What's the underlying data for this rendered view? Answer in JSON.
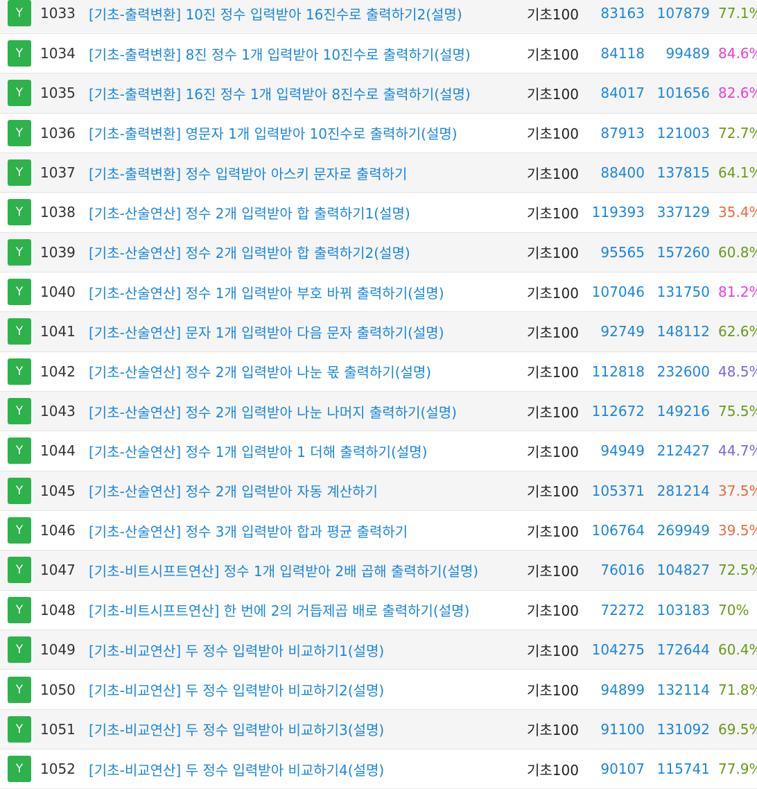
{
  "problems": [
    {
      "status": "Y",
      "id": "1033",
      "title": "[기초-출력변환] 10진 정수 입력받아 16진수로 출력하기2(설명)",
      "source": "기초100",
      "solved": "83163",
      "submitted": "107879",
      "rate": "77.1%",
      "rate_color": "#6a9a16"
    },
    {
      "status": "Y",
      "id": "1034",
      "title": "[기초-출력변환] 8진 정수 1개 입력받아 10진수로 출력하기(설명)",
      "source": "기초100",
      "solved": "84118",
      "submitted": "99489",
      "rate": "84.6%",
      "rate_color": "#e93ed8"
    },
    {
      "status": "Y",
      "id": "1035",
      "title": "[기초-출력변환] 16진 정수 1개 입력받아 8진수로 출력하기(설명)",
      "source": "기초100",
      "solved": "84017",
      "submitted": "101656",
      "rate": "82.6%",
      "rate_color": "#e93ed8"
    },
    {
      "status": "Y",
      "id": "1036",
      "title": "[기초-출력변환] 영문자 1개 입력받아 10진수로 출력하기(설명)",
      "source": "기초100",
      "solved": "87913",
      "submitted": "121003",
      "rate": "72.7%",
      "rate_color": "#6a9a16"
    },
    {
      "status": "Y",
      "id": "1037",
      "title": "[기초-출력변환] 정수 입력받아 아스키 문자로 출력하기",
      "source": "기초100",
      "solved": "88400",
      "submitted": "137815",
      "rate": "64.1%",
      "rate_color": "#6a9a16"
    },
    {
      "status": "Y",
      "id": "1038",
      "title": "[기초-산술연산] 정수 2개 입력받아 합 출력하기1(설명)",
      "source": "기초100",
      "solved": "119393",
      "submitted": "337129",
      "rate": "35.4%",
      "rate_color": "#ee6a3a"
    },
    {
      "status": "Y",
      "id": "1039",
      "title": "[기초-산술연산] 정수 2개 입력받아 합 출력하기2(설명)",
      "source": "기초100",
      "solved": "95565",
      "submitted": "157260",
      "rate": "60.8%",
      "rate_color": "#6a9a16"
    },
    {
      "status": "Y",
      "id": "1040",
      "title": "[기초-산술연산] 정수 1개 입력받아 부호 바꿔 출력하기(설명)",
      "source": "기초100",
      "solved": "107046",
      "submitted": "131750",
      "rate": "81.2%",
      "rate_color": "#e93ed8"
    },
    {
      "status": "Y",
      "id": "1041",
      "title": "[기초-산술연산] 문자 1개 입력받아 다음 문자 출력하기(설명)",
      "source": "기초100",
      "solved": "92749",
      "submitted": "148112",
      "rate": "62.6%",
      "rate_color": "#6a9a16"
    },
    {
      "status": "Y",
      "id": "1042",
      "title": "[기초-산술연산] 정수 2개 입력받아 나눈 몫 출력하기(설명)",
      "source": "기초100",
      "solved": "112818",
      "submitted": "232600",
      "rate": "48.5%",
      "rate_color": "#7a63e0"
    },
    {
      "status": "Y",
      "id": "1043",
      "title": "[기초-산술연산] 정수 2개 입력받아 나눈 나머지 출력하기(설명)",
      "source": "기초100",
      "solved": "112672",
      "submitted": "149216",
      "rate": "75.5%",
      "rate_color": "#6a9a16"
    },
    {
      "status": "Y",
      "id": "1044",
      "title": "[기초-산술연산] 정수 1개 입력받아 1 더해 출력하기(설명)",
      "source": "기초100",
      "solved": "94949",
      "submitted": "212427",
      "rate": "44.7%",
      "rate_color": "#7a63e0"
    },
    {
      "status": "Y",
      "id": "1045",
      "title": "[기초-산술연산] 정수 2개 입력받아 자동 계산하기",
      "source": "기초100",
      "solved": "105371",
      "submitted": "281214",
      "rate": "37.5%",
      "rate_color": "#ee6a3a"
    },
    {
      "status": "Y",
      "id": "1046",
      "title": "[기초-산술연산] 정수 3개 입력받아 합과 평균 출력하기",
      "source": "기초100",
      "solved": "106764",
      "submitted": "269949",
      "rate": "39.5%",
      "rate_color": "#ee6a3a"
    },
    {
      "status": "Y",
      "id": "1047",
      "title": "[기초-비트시프트연산] 정수 1개 입력받아 2배 곱해 출력하기(설명)",
      "source": "기초100",
      "solved": "76016",
      "submitted": "104827",
      "rate": "72.5%",
      "rate_color": "#6a9a16"
    },
    {
      "status": "Y",
      "id": "1048",
      "title": "[기초-비트시프트연산] 한 번에 2의 거듭제곱 배로 출력하기(설명)",
      "source": "기초100",
      "solved": "72272",
      "submitted": "103183",
      "rate": "70%",
      "rate_color": "#6a9a16"
    },
    {
      "status": "Y",
      "id": "1049",
      "title": "[기초-비교연산] 두 정수 입력받아 비교하기1(설명)",
      "source": "기초100",
      "solved": "104275",
      "submitted": "172644",
      "rate": "60.4%",
      "rate_color": "#6a9a16"
    },
    {
      "status": "Y",
      "id": "1050",
      "title": "[기초-비교연산] 두 정수 입력받아 비교하기2(설명)",
      "source": "기초100",
      "solved": "94899",
      "submitted": "132114",
      "rate": "71.8%",
      "rate_color": "#6a9a16"
    },
    {
      "status": "Y",
      "id": "1051",
      "title": "[기초-비교연산] 두 정수 입력받아 비교하기3(설명)",
      "source": "기초100",
      "solved": "91100",
      "submitted": "131092",
      "rate": "69.5%",
      "rate_color": "#6a9a16"
    },
    {
      "status": "Y",
      "id": "1052",
      "title": "[기초-비교연산] 두 정수 입력받아 비교하기4(설명)",
      "source": "기초100",
      "solved": "90107",
      "submitted": "115741",
      "rate": "77.9%",
      "rate_color": "#6a9a16"
    }
  ]
}
